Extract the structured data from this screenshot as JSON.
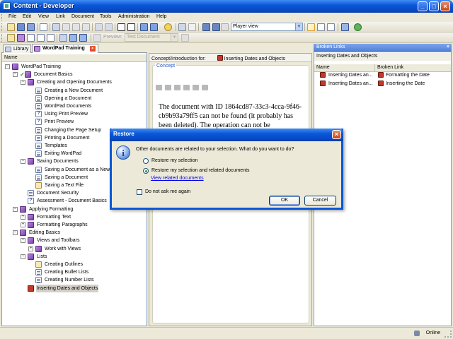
{
  "window": {
    "title": "Content - Developer",
    "buttons": [
      "minimize",
      "maximize",
      "close"
    ]
  },
  "menu": [
    {
      "label": "File",
      "key": "F"
    },
    {
      "label": "Edit",
      "key": "E"
    },
    {
      "label": "View",
      "key": "V"
    },
    {
      "label": "Link",
      "key": "L"
    },
    {
      "label": "Document",
      "key": "D"
    },
    {
      "label": "Tools",
      "key": "T"
    },
    {
      "label": "Administration",
      "key": "A"
    },
    {
      "label": "Help",
      "key": "H"
    }
  ],
  "toolbar": {
    "view_mode": "Player view",
    "preview_label": "Preview:",
    "preview_select": "Test Document"
  },
  "left_panel": {
    "tabs": [
      {
        "label": "Library"
      },
      {
        "label": "WordPad Training"
      }
    ],
    "column_header": "Name",
    "tree": [
      {
        "label": "WordPad Training",
        "indent": 0,
        "toggle": "-",
        "icon": "book"
      },
      {
        "label": "Document Basics",
        "indent": 1,
        "toggle": "-",
        "icon": "book",
        "check": true
      },
      {
        "label": "Creating and Opening Documents",
        "indent": 2,
        "toggle": "-",
        "icon": "book"
      },
      {
        "label": "Creating a New Document",
        "indent": 3,
        "icon": "page"
      },
      {
        "label": "Opening a Document",
        "indent": 3,
        "icon": "page"
      },
      {
        "label": "WordPad Documents",
        "indent": 3,
        "icon": "page"
      },
      {
        "label": "Using Print Preview",
        "indent": 3,
        "icon": "q"
      },
      {
        "label": "Print Preview",
        "indent": 3,
        "icon": "q"
      },
      {
        "label": "Changing the Page Setup",
        "indent": 3,
        "icon": "page"
      },
      {
        "label": "Printing a Document",
        "indent": 3,
        "icon": "page"
      },
      {
        "label": "Templates",
        "indent": 3,
        "icon": "page"
      },
      {
        "label": "Exiting WordPad",
        "indent": 3,
        "icon": "page"
      },
      {
        "label": "Saving Documents",
        "indent": 2,
        "toggle": "-",
        "icon": "book"
      },
      {
        "label": "Saving a Document as a New",
        "indent": 3,
        "icon": "page"
      },
      {
        "label": "Saving a Document",
        "indent": 3,
        "icon": "page"
      },
      {
        "label": "Saving a Text File",
        "indent": 3,
        "icon": "ans"
      },
      {
        "label": "Document Security",
        "indent": 2,
        "icon": "page"
      },
      {
        "label": "Assessment - Document Basics",
        "indent": 2,
        "icon": "q"
      },
      {
        "label": "Applying Formatting",
        "indent": 1,
        "toggle": "-",
        "icon": "book"
      },
      {
        "label": "Formatting Text",
        "indent": 2,
        "toggle": "+",
        "icon": "book"
      },
      {
        "label": "Formatting Paragraphs",
        "indent": 2,
        "toggle": "+",
        "icon": "book"
      },
      {
        "label": "Editing Basics",
        "indent": 1,
        "toggle": "-",
        "icon": "book"
      },
      {
        "label": "Views and Toolbars",
        "indent": 2,
        "toggle": "-",
        "icon": "book"
      },
      {
        "label": "Work with Views",
        "indent": 3,
        "toggle": "+",
        "icon": "book"
      },
      {
        "label": "Lists",
        "indent": 2,
        "toggle": "-",
        "icon": "book"
      },
      {
        "label": "Creating Outlines",
        "indent": 3,
        "icon": "ans"
      },
      {
        "label": "Creating Bullet Lists",
        "indent": 3,
        "icon": "page"
      },
      {
        "label": "Creating Number Lists",
        "indent": 3,
        "icon": "page"
      },
      {
        "label": "Inserting Dates and Objects",
        "indent": 2,
        "icon": "rec",
        "selected": true
      }
    ]
  },
  "middle_panel": {
    "header_label": "Concept/Introduction for:",
    "header_doc": "Inserting Dates and Objects",
    "section_label": "Concept",
    "message": "The document with ID 1864cd87-33c3-4cca-9f46-cb9b93a79ff5 can not be found (it probably has been deleted). The operation can not be"
  },
  "right_panel": {
    "title": "Broken Links",
    "subtitle": "Inserting Dates and Objects",
    "columns": [
      "Name",
      "Broken Link"
    ],
    "rows": [
      {
        "name": "Inserting Dates an...",
        "link": "Formatting the Date"
      },
      {
        "name": "Inserting Dates an...",
        "link": "Inserting the Date"
      }
    ]
  },
  "dialog": {
    "title": "Restore",
    "message": "Other documents are related to your selection. What do you want to do?",
    "options": [
      {
        "label": "Restore my selection",
        "selected": false
      },
      {
        "label": "Restore my selection and related documents",
        "selected": true
      }
    ],
    "link": "View related documents",
    "checkbox": {
      "label": "Do not ask me again",
      "checked": false
    },
    "ok": "OK",
    "cancel": "Cancel"
  },
  "status": {
    "online": "Online"
  }
}
